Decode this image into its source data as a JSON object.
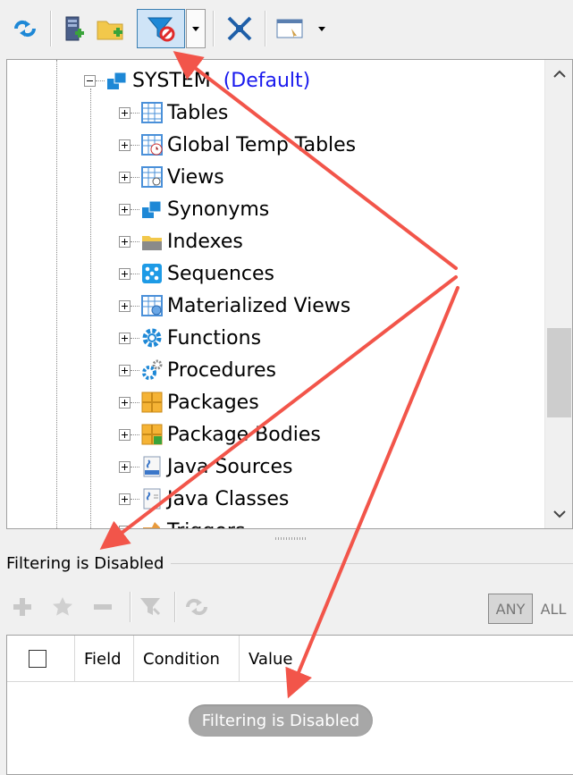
{
  "toolbar": {
    "buttons": [
      {
        "name": "refresh-icon"
      },
      {
        "name": "new-database-icon"
      },
      {
        "name": "new-folder-icon"
      },
      {
        "name": "filter-disabled-icon",
        "active": true
      },
      {
        "name": "collapse-all-icon"
      },
      {
        "name": "view-options-icon"
      }
    ]
  },
  "tree": {
    "schema": {
      "label": "SYSTEM",
      "default_label": "(Default)"
    },
    "items": [
      {
        "label": "Tables",
        "icon": "tables-icon"
      },
      {
        "label": "Global Temp Tables",
        "icon": "global-temp-tables-icon"
      },
      {
        "label": "Views",
        "icon": "views-icon"
      },
      {
        "label": "Synonyms",
        "icon": "synonyms-icon"
      },
      {
        "label": "Indexes",
        "icon": "indexes-icon"
      },
      {
        "label": "Sequences",
        "icon": "sequences-icon"
      },
      {
        "label": "Materialized Views",
        "icon": "materialized-views-icon"
      },
      {
        "label": "Functions",
        "icon": "functions-icon"
      },
      {
        "label": "Procedures",
        "icon": "procedures-icon"
      },
      {
        "label": "Packages",
        "icon": "packages-icon"
      },
      {
        "label": "Package Bodies",
        "icon": "package-bodies-icon"
      },
      {
        "label": "Java Sources",
        "icon": "java-sources-icon"
      },
      {
        "label": "Java Classes",
        "icon": "java-classes-icon"
      },
      {
        "label": "Triggers",
        "icon": "triggers-icon"
      }
    ]
  },
  "filter": {
    "header": "Filtering is Disabled",
    "any_label": "ANY",
    "all_label": "ALL",
    "columns": [
      "Field",
      "Condition",
      "Value"
    ],
    "status_pill": "Filtering is Disabled"
  },
  "colors": {
    "annotation_arrow": "#f2554a",
    "default_link": "#1a1aee",
    "active_button_border": "#3c7fb1"
  }
}
